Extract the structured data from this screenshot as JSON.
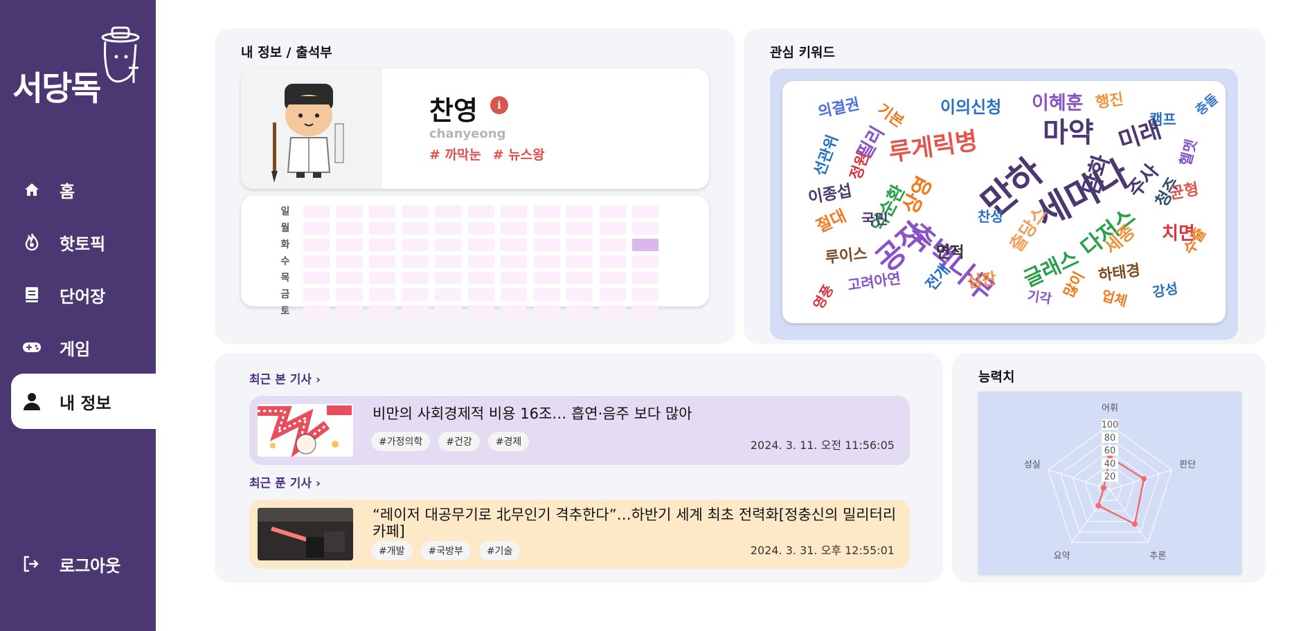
{
  "app": {
    "logo_text": "서당독"
  },
  "sidebar": {
    "items": [
      {
        "label": "홈",
        "icon": "home-icon"
      },
      {
        "label": "핫토픽",
        "icon": "fire-icon"
      },
      {
        "label": "단어장",
        "icon": "book-icon"
      },
      {
        "label": "게임",
        "icon": "gamepad-icon"
      },
      {
        "label": "내 정보",
        "icon": "user-icon",
        "active": true
      }
    ],
    "logout_label": "로그아웃"
  },
  "profile": {
    "section_title": "내 정보 / 출석부",
    "name": "찬영",
    "info_icon": "i",
    "username": "chanyeong",
    "tags": [
      "# 까막눈",
      "# 뉴스왕"
    ]
  },
  "attendance": {
    "days": [
      "일",
      "월",
      "화",
      "수",
      "목",
      "금",
      "토"
    ],
    "weeks": 11,
    "checked": [
      {
        "week": 10,
        "day": 2
      }
    ],
    "empty_color": "#fdeefb",
    "checked_color": "#d9b8ef"
  },
  "keywords": {
    "section_title": "관심 키워드",
    "words": [
      "의결권",
      "기본",
      "이의신청",
      "이혜훈",
      "행진",
      "캠프",
      "충돌",
      "선관위",
      "필리",
      "루게릭병",
      "만하",
      "마약",
      "미래",
      "헬멧",
      "정원",
      "세미나",
      "주사",
      "상영",
      "악순환",
      "청주",
      "이종섭",
      "축백나무",
      "담화",
      "균형",
      "절대",
      "국민",
      "출당스",
      "찬성",
      "다저스",
      "치면",
      "공작",
      "면적",
      "세종",
      "루이스",
      "글래스",
      "수출",
      "전개",
      "하태경",
      "심판",
      "많이",
      "고려아연",
      "강성",
      "업체",
      "기각",
      "영풍"
    ]
  },
  "recent_viewed": {
    "title": "최근 본 기사",
    "article": {
      "title": "비만의 사회경제적 비용 16조… 흡연·음주 보다 많아",
      "tags": [
        "#가정의학",
        "#건강",
        "#경제"
      ],
      "date": "2024. 3. 11. 오전 11:56:05",
      "bg": "#e3dcf2"
    }
  },
  "recent_solved": {
    "title": "최근 푼 기사",
    "article": {
      "title": "“레이저 대공무기로 北무인기 격추한다”…하반기 세계 최초 전력화[정충신의 밀리터리 카페]",
      "tags": [
        "#개발",
        "#국방부",
        "#기술"
      ],
      "date": "2024. 3. 31. 오후 12:55:01",
      "bg": "#fde9c8"
    }
  },
  "abilities": {
    "section_title": "능력치",
    "chart_data": {
      "type": "radar",
      "axes": [
        "어휘",
        "판단",
        "추론",
        "요약",
        "성실"
      ],
      "ticks": [
        20,
        40,
        60,
        80,
        100
      ],
      "range": [
        0,
        100
      ],
      "series": [
        {
          "values": [
            50,
            55,
            65,
            30,
            10
          ]
        }
      ],
      "color": "#f06b6b",
      "background": "#d4ddf6"
    }
  }
}
